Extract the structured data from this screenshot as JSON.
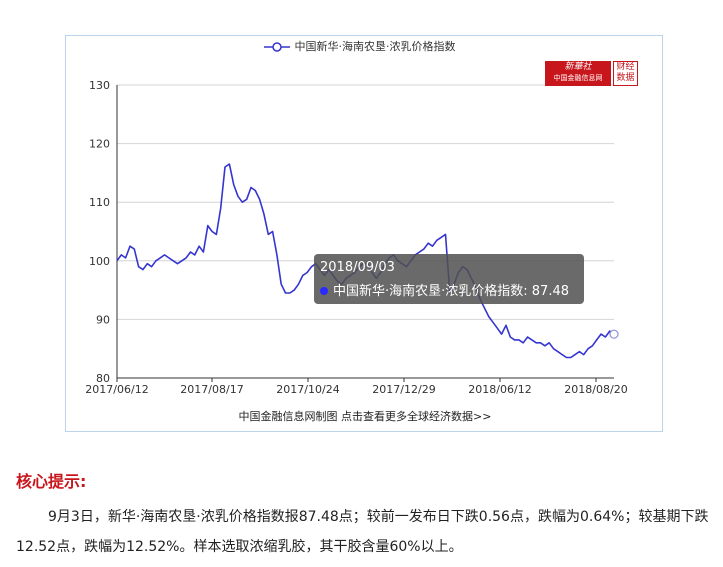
{
  "chart_data": {
    "type": "line",
    "legend": "中国新华·海南农垦·浓乳价格指数",
    "legend_position": "top-center",
    "x_ticks": [
      "2017/06/12",
      "2017/08/17",
      "2017/10/24",
      "2017/12/29",
      "2018/06/12",
      "2018/08/20"
    ],
    "y_ticks": [
      80,
      90,
      100,
      110,
      120,
      130
    ],
    "ylim": [
      80,
      130
    ],
    "grid": true,
    "series": [
      {
        "name": "中国新华·海南农垦·浓乳价格指数",
        "color": "#3535d0",
        "values": [
          100.0,
          101.0,
          100.5,
          102.5,
          102.0,
          99.0,
          98.5,
          99.5,
          99.0,
          100.0,
          100.5,
          101.0,
          100.5,
          100.0,
          99.5,
          100.0,
          100.5,
          101.5,
          101.0,
          102.5,
          101.5,
          106.0,
          105.0,
          104.5,
          109.0,
          116.0,
          116.5,
          113.0,
          111.0,
          110.0,
          110.5,
          112.5,
          112.0,
          110.5,
          108.0,
          104.5,
          105.0,
          101.0,
          96.0,
          94.5,
          94.5,
          95.0,
          96.0,
          97.5,
          98.0,
          99.0,
          99.5,
          98.5,
          97.5,
          98.5,
          97.5,
          96.5,
          96.0,
          97.0,
          97.5,
          98.0,
          99.0,
          99.5,
          99.5,
          98.0,
          97.0,
          98.0,
          99.5,
          100.5,
          101.0,
          100.0,
          99.5,
          99.0,
          100.0,
          101.0,
          101.5,
          102.0,
          103.0,
          102.5,
          103.5,
          104.0,
          104.5,
          94.5,
          96.0,
          98.0,
          99.0,
          98.5,
          97.0,
          95.5,
          93.5,
          92.0,
          90.5,
          89.5,
          88.5,
          87.5,
          89.0,
          87.0,
          86.5,
          86.5,
          86.0,
          87.0,
          86.5,
          86.0,
          86.0,
          85.5,
          86.0,
          85.0,
          84.5,
          84.0,
          83.5,
          83.5,
          84.0,
          84.5,
          84.0,
          85.0,
          85.5,
          86.5,
          87.5,
          87.0,
          88.0,
          87.48
        ]
      }
    ],
    "tooltip": {
      "date": "2018/09/03",
      "label": "中国新华·海南农垦·浓乳价格指数: 87.48"
    },
    "footer": "中国金融信息网制图 点击查看更多全球经济数据>>",
    "logo": {
      "line1": "新華社",
      "line2": "中国金融信息网",
      "box": "财经数据"
    }
  },
  "article": {
    "section_title": "核心提示:",
    "summary": "9月3日，新华·海南农垦·浓乳价格指数报87.48点；较前一发布日下跌0.56点，跌幅为0.64%；较基期下跌12.52点，跌幅为12.52%。样本选取浓缩乳胶，其干胶含量60%以上。"
  }
}
